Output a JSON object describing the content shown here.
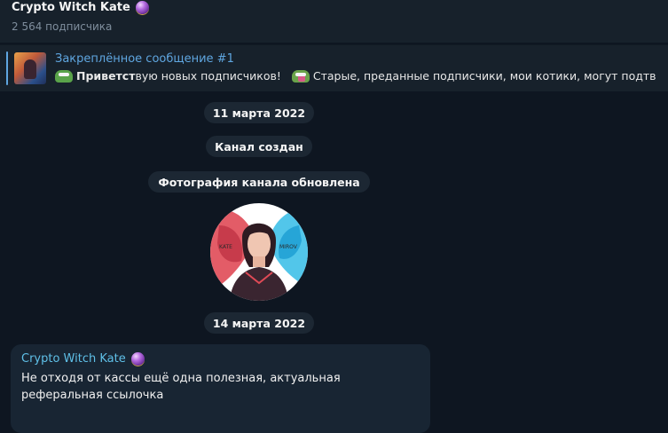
{
  "header": {
    "channel_name": "Crypto Witch Kate",
    "channel_icon": "crystal-ball-icon",
    "subscribers": "2 564 подписчика"
  },
  "pinned": {
    "title": "Закреплённое сообщение #1",
    "text_bold": "Приветст",
    "text_part1": "вую новых подписчиков!",
    "text_part2": "Старые, преданные подписчики, мои котики, могут подтв",
    "emoji_1": "pepe-icon",
    "emoji_2": "pepe-gift-icon"
  },
  "service_messages": {
    "date_1": "11 марта 2022",
    "channel_created": "Канал создан",
    "photo_updated": "Фотография канала обновлена",
    "date_2": "14 марта 2022"
  },
  "message": {
    "author": "Crypto Witch Kate",
    "author_icon": "crystal-ball-icon",
    "text": "Не отходя от кассы ещё одна полезная, актуальная реферальная ссылочка"
  },
  "avatar_text": {
    "left": "KATE",
    "right": "MIROV"
  },
  "colors": {
    "background": "#0e1621",
    "panel": "#17212b",
    "accent": "#5fa6e0",
    "author": "#5fc0e8",
    "service_pill": "#1c2733",
    "bubble": "#182533"
  }
}
